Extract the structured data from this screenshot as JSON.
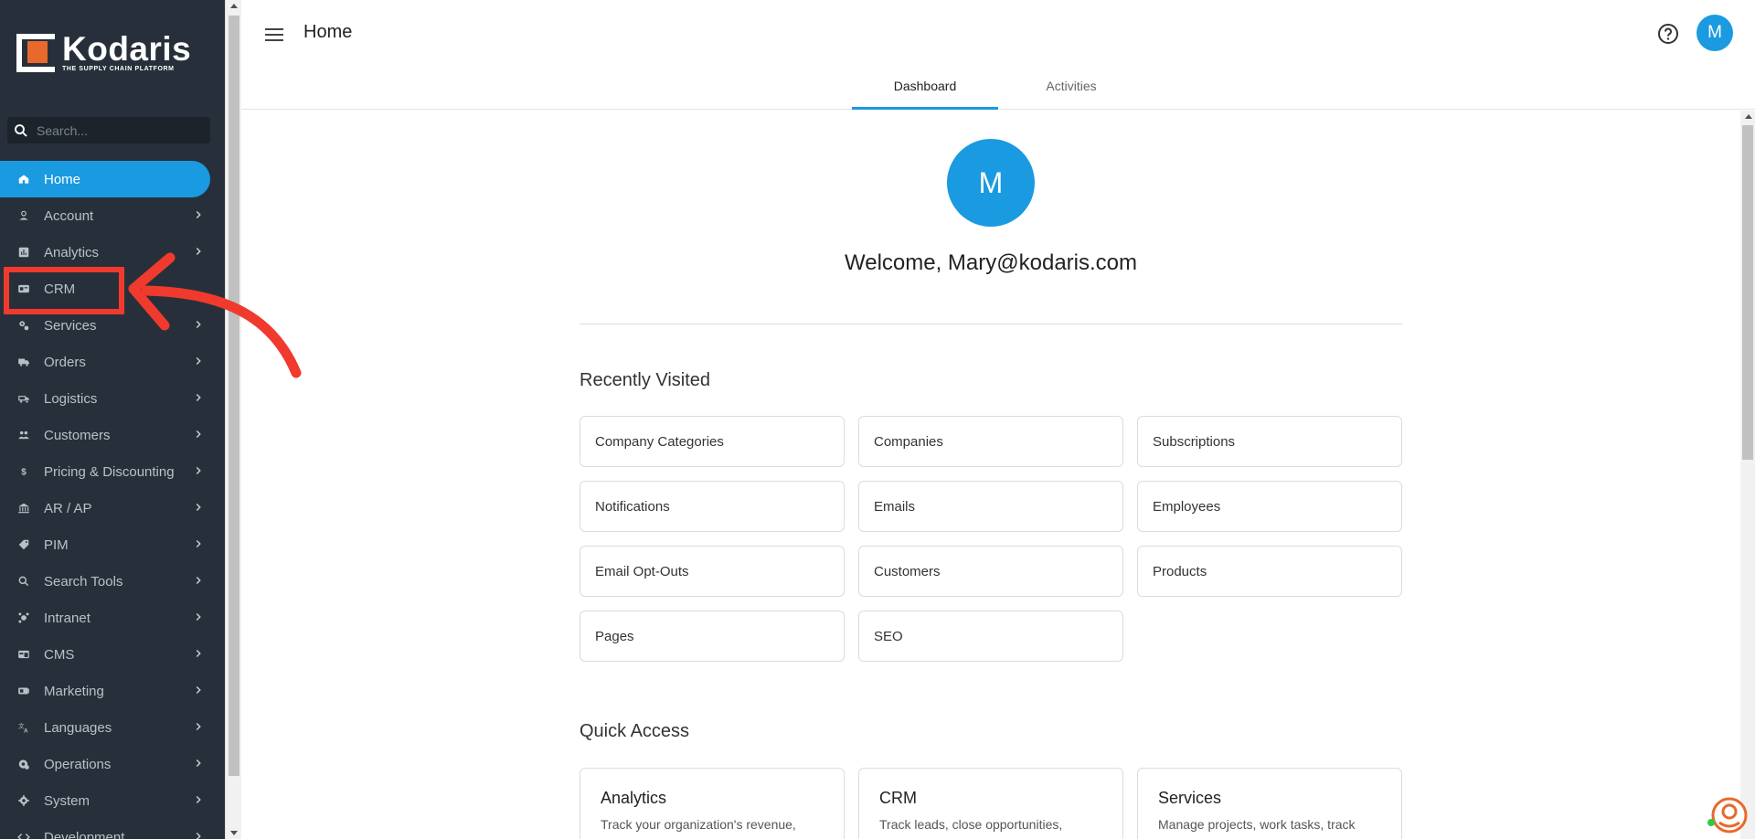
{
  "brand": {
    "name": "Kodaris",
    "tagline": "THE SUPPLY CHAIN PLATFORM"
  },
  "search": {
    "placeholder": "Search..."
  },
  "sidebar": {
    "items": [
      {
        "label": "Home",
        "icon": "home-icon",
        "active": true
      },
      {
        "label": "Account",
        "icon": "person-icon"
      },
      {
        "label": "Analytics",
        "icon": "analytics-icon"
      },
      {
        "label": "CRM",
        "icon": "contact-card-icon"
      },
      {
        "label": "Services",
        "icon": "gears-icon"
      },
      {
        "label": "Orders",
        "icon": "truck-icon"
      },
      {
        "label": "Logistics",
        "icon": "shipping-icon"
      },
      {
        "label": "Customers",
        "icon": "people-icon"
      },
      {
        "label": "Pricing & Discounting",
        "icon": "dollar-icon"
      },
      {
        "label": "AR / AP",
        "icon": "bank-icon"
      },
      {
        "label": "PIM",
        "icon": "tag-icon"
      },
      {
        "label": "Search Tools",
        "icon": "search-icon"
      },
      {
        "label": "Intranet",
        "icon": "hub-icon"
      },
      {
        "label": "CMS",
        "icon": "web-icon"
      },
      {
        "label": "Marketing",
        "icon": "megaphone-icon"
      },
      {
        "label": "Languages",
        "icon": "translate-icon"
      },
      {
        "label": "Operations",
        "icon": "cog-cloud-icon"
      },
      {
        "label": "System",
        "icon": "gear-icon"
      },
      {
        "label": "Development",
        "icon": "code-icon"
      }
    ]
  },
  "header": {
    "title": "Home",
    "avatar_initial": "M"
  },
  "tabs": [
    {
      "label": "Dashboard",
      "active": true
    },
    {
      "label": "Activities"
    }
  ],
  "welcome": {
    "avatar_initial": "M",
    "text": "Welcome, Mary@kodaris.com"
  },
  "recently_visited": {
    "title": "Recently Visited",
    "items": [
      "Company Categories",
      "Companies",
      "Subscriptions",
      "Notifications",
      "Emails",
      "Employees",
      "Email Opt-Outs",
      "Customers",
      "Products",
      "Pages",
      "SEO"
    ]
  },
  "quick_access": {
    "title": "Quick Access",
    "items": [
      {
        "title": "Analytics",
        "desc": "Track your organization's revenue,"
      },
      {
        "title": "CRM",
        "desc": "Track leads, close opportunities,"
      },
      {
        "title": "Services",
        "desc": "Manage projects, work tasks, track"
      }
    ]
  },
  "colors": {
    "accent": "#1a9ae0",
    "sidebar": "#27303a",
    "annotation": "#f03a2e",
    "brand_orange": "#e8692b"
  }
}
